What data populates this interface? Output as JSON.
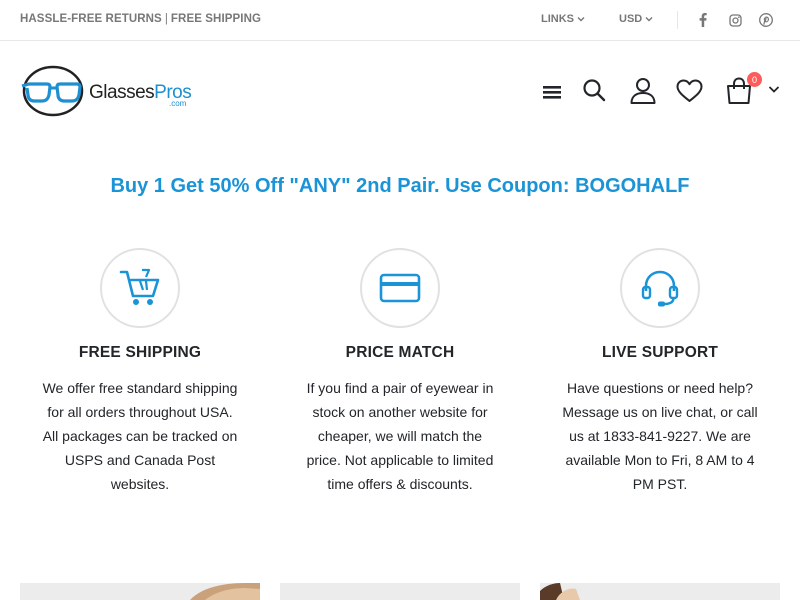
{
  "topbar": {
    "left_part1": "HASSLE-FREE RETURNS",
    "separator": "|",
    "left_part2": "FREE SHIPPING",
    "links_label": "LINKS",
    "currency_label": "USD",
    "social": [
      "facebook-icon",
      "instagram-icon",
      "pinterest-icon"
    ]
  },
  "header": {
    "logo_main": "Glasses",
    "logo_accent": "Pros",
    "logo_suffix": ".com",
    "cart_count": "0",
    "icons": [
      "menu-icon",
      "search-icon",
      "user-icon",
      "heart-icon",
      "cart-icon",
      "chevron-down-icon"
    ]
  },
  "promo": {
    "text": "Buy 1 Get 50% Off \"ANY\" 2nd Pair. Use Coupon: BOGOHALF"
  },
  "features": [
    {
      "icon": "cart-icon",
      "title": "FREE SHIPPING",
      "text": "We offer free standard shipping for all orders throughout USA. All packages can be tracked on USPS and Canada Post websites."
    },
    {
      "icon": "credit-card-icon",
      "title": "PRICE MATCH",
      "text": "If you find a pair of eyewear in stock on another website for cheaper, we will match the price. Not applicable to limited time offers & discounts."
    },
    {
      "icon": "headset-icon",
      "title": "LIVE SUPPORT",
      "text": "Have questions or need help? Message us on live chat, or call us at 1833-841-9227. We are available Mon to Fri, 8 AM to 4 PM PST."
    }
  ],
  "colors": {
    "accent": "#1a93d7",
    "badge": "#ff5b5b",
    "text": "#222529",
    "muted": "#777777"
  }
}
